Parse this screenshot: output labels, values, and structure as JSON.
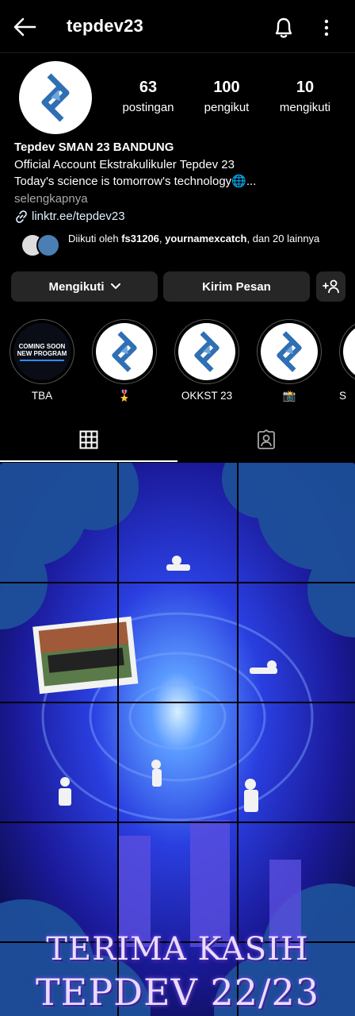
{
  "header": {
    "username": "tepdev23"
  },
  "profile": {
    "stats": [
      {
        "value": "63",
        "label": "postingan"
      },
      {
        "value": "100",
        "label": "pengikut"
      },
      {
        "value": "10",
        "label": "mengikuti"
      }
    ],
    "bio": {
      "name": "Tepdev SMAN 23 BANDUNG",
      "line1": "Official Account Ekstrakulikuler Tepdev 23",
      "line2": "Today's science is tomorrow's technology🌐...",
      "more": "selengkapnya",
      "link": "linktr.ee/tepdev23"
    },
    "followed_by": {
      "prefix": "Diikuti oleh ",
      "user1": "fs31206",
      "sep": ", ",
      "user2": "yournamexcatch",
      "suffix": ", dan 20 lainnya"
    }
  },
  "actions": {
    "follow": "Mengikuti",
    "message": "Kirim Pesan"
  },
  "highlights": [
    {
      "label": "TBA",
      "thumb_line1": "COMING SOON",
      "thumb_line2": "NEW PROGRAM"
    },
    {
      "label": "🎖️"
    },
    {
      "label": "OKKST 23"
    },
    {
      "label": "📸"
    },
    {
      "label": "S"
    }
  ],
  "posts": {
    "overlay_line1": "TERIMA KASIH",
    "overlay_line2": "TEPDEV 22/23"
  },
  "colors": {
    "background": "#000000",
    "button": "#262626",
    "link": "#e0f1ff",
    "logo_blue": "#2f6fb3"
  }
}
